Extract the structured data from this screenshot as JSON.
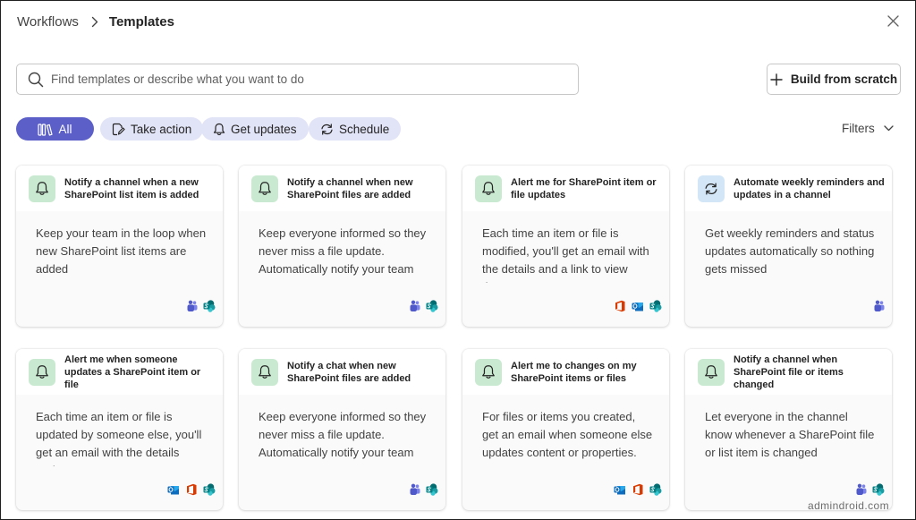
{
  "header": {
    "root": "Workflows",
    "current": "Templates",
    "close_label": "Close"
  },
  "search": {
    "placeholder": "Find templates or describe what you want to do",
    "value": ""
  },
  "build_button": {
    "label": "Build from scratch"
  },
  "filter_pills": [
    {
      "label": "All",
      "icon": "books-icon",
      "active": true
    },
    {
      "label": "Take action",
      "icon": "edit-icon",
      "active": false
    },
    {
      "label": "Get updates",
      "icon": "bell-icon",
      "active": false
    },
    {
      "label": "Schedule",
      "icon": "arrow-sync-icon",
      "active": false
    }
  ],
  "filters": {
    "label": "Filters"
  },
  "cards": [
    {
      "title": "Notify a channel when a new SharePoint list item is added",
      "description": "Keep your team in the loop when new SharePoint list items are added",
      "icon": "bell-icon",
      "apps": [
        "teams",
        "sharepoint"
      ]
    },
    {
      "title": "Notify a channel when new SharePoint files are added",
      "description": "Keep everyone informed so they never miss a file update. Automatically notify your team t...",
      "icon": "bell-icon",
      "apps": [
        "teams",
        "sharepoint"
      ]
    },
    {
      "title": "Alert me for SharePoint item or file updates",
      "description": "Each time an item or file is modified, you'll get an email with the details and a link to view the...",
      "icon": "bell-icon",
      "apps": [
        "office",
        "outlook",
        "sharepoint"
      ]
    },
    {
      "title": "Automate weekly reminders and updates in a channel",
      "description": "Get weekly reminders and status updates automatically so nothing gets missed",
      "icon": "arrow-sync-icon",
      "apps": [
        "teams"
      ]
    },
    {
      "title": "Alert me when someone updates a SharePoint item or file",
      "description": "Each time an item or file is updated by someone else, you'll get an email with the details and...",
      "icon": "bell-icon",
      "apps": [
        "outlook",
        "office",
        "sharepoint"
      ]
    },
    {
      "title": "Notify a chat when new SharePoint files are added",
      "description": "Keep everyone informed so they never miss a file update. Automatically notify your team t...",
      "icon": "bell-icon",
      "apps": [
        "teams",
        "sharepoint"
      ]
    },
    {
      "title": "Alert me to changes on my SharePoint items or files",
      "description": "For files or items you created, get an email when someone else updates content or properties.",
      "icon": "bell-icon",
      "apps": [
        "outlook",
        "office",
        "sharepoint"
      ]
    },
    {
      "title": "Notify a channel when SharePoint file or items changed",
      "description": "Let everyone in the channel know whenever a SharePoint file or list item is changed",
      "icon": "bell-icon",
      "apps": [
        "teams",
        "sharepoint"
      ]
    }
  ],
  "watermark": "admindroid.com",
  "colors": {
    "accent": "#5b5fc7",
    "pill_bg": "#e1e3f6",
    "tile_green": "#c9ead1",
    "tile_blue": "#d2e6f7",
    "teams": "#5059c9",
    "sharepoint": "#038387",
    "office": "#d83b01",
    "outlook": "#0f6cbd"
  }
}
